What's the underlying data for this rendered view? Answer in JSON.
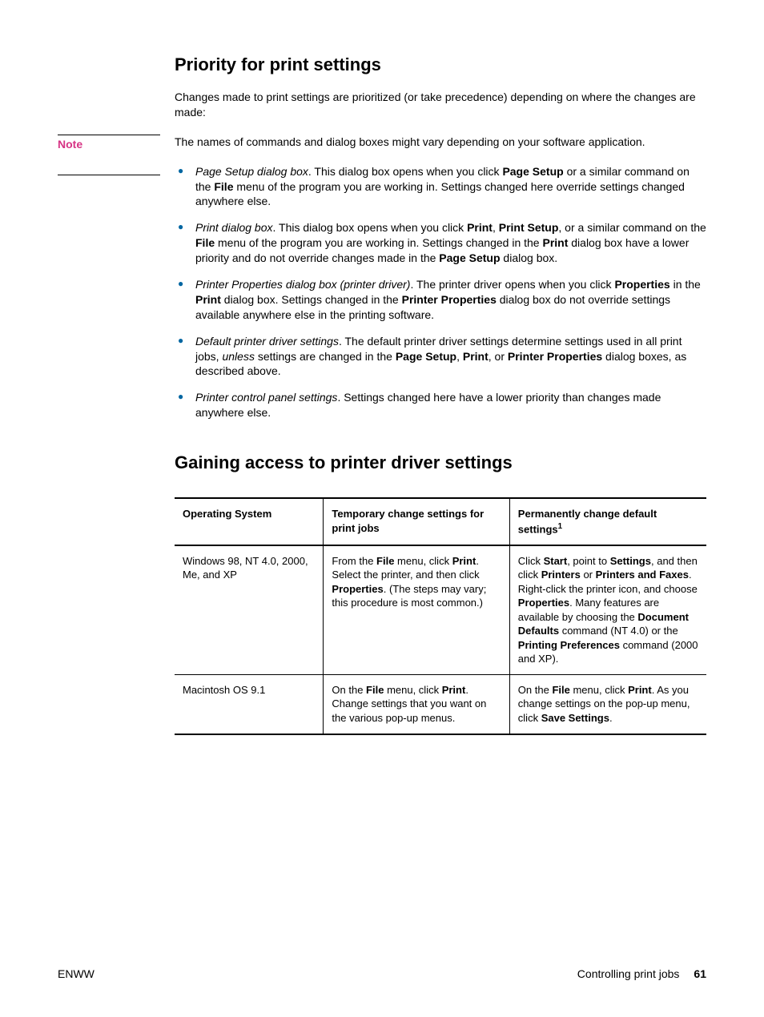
{
  "section1": {
    "heading": "Priority for print settings",
    "intro": "Changes made to print settings are prioritized (or take precedence) depending on where the changes are made:",
    "note_label": "Note",
    "note_text": "The names of commands and dialog boxes might vary depending on your software application.",
    "bullets": [
      {
        "lead_italic": "Page Setup dialog box",
        "t1": ". This dialog box opens when you click ",
        "b1": "Page Setup",
        "t2": " or a similar command on the ",
        "b2": "File",
        "t3": " menu of the program you are working in. Settings changed here override settings changed anywhere else."
      },
      {
        "lead_italic": "Print dialog box",
        "t1": ". This dialog box opens when you click ",
        "b1": "Print",
        "t2": ", ",
        "b2": "Print Setup",
        "t3": ", or a similar command on the ",
        "b3": "File",
        "t4": " menu of the program you are working in. Settings changed in the ",
        "b4": "Print",
        "t5": " dialog box have a lower priority and do not override changes made in the ",
        "b5": "Page Setup",
        "t6": " dialog box."
      },
      {
        "lead_italic": "Printer Properties dialog box (printer driver)",
        "t1": ". The printer driver opens when you click ",
        "b1": "Properties",
        "t2": " in the ",
        "b2": "Print",
        "t3": " dialog box. Settings changed in the ",
        "b3": "Printer Properties",
        "t4": " dialog box do not override settings available anywhere else in the printing software."
      },
      {
        "lead_italic": "Default printer driver settings",
        "t1": ". The default printer driver settings determine settings used in all print jobs, ",
        "i1": "unless",
        "t2": " settings are changed in the ",
        "b1": "Page Setup",
        "t3": ", ",
        "b2": "Print",
        "t4": ", or ",
        "b3": "Printer Properties",
        "t5": " dialog boxes, as described above."
      },
      {
        "lead_italic": "Printer control panel settings",
        "t1": ". Settings changed here have a lower priority than changes made anywhere else."
      }
    ]
  },
  "section2": {
    "heading": "Gaining access to printer driver settings",
    "table": {
      "headers": {
        "os": "Operating System",
        "temp": "Temporary change settings for print jobs",
        "perm_a": "Permanently change default settings",
        "perm_sup": "1"
      },
      "rows": [
        {
          "os": "Windows 98, NT 4.0, 2000, Me, and XP",
          "temp": {
            "t1": "From the ",
            "b1": "File",
            "t2": " menu, click ",
            "b2": "Print",
            "t3": ". Select the printer, and then click ",
            "b3": "Properties",
            "t4": ". (The steps may vary; this procedure is most common.)"
          },
          "perm": {
            "t1": "Click ",
            "b1": "Start",
            "t2": ", point to ",
            "b2": "Settings",
            "t3": ", and then click ",
            "b3": "Printers",
            "t4": " or ",
            "b4": "Printers and Faxes",
            "t5": ". Right-click the printer icon, and choose ",
            "b5": "Properties",
            "t6": ". Many features are available by choosing the ",
            "b6": "Document Defaults",
            "t7": " command (NT 4.0) or the ",
            "b7": "Printing Preferences",
            "t8": " command (2000 and XP)."
          }
        },
        {
          "os": "Macintosh OS 9.1",
          "temp": {
            "t1": "On the ",
            "b1": "File",
            "t2": " menu, click ",
            "b2": "Print",
            "t3": ". Change settings that you want on the various pop-up menus."
          },
          "perm": {
            "t1": "On the ",
            "b1": "File",
            "t2": " menu, click ",
            "b2": "Print",
            "t3": ". As you change settings on the pop-up menu, click ",
            "b3": "Save Settings",
            "t4": "."
          }
        }
      ]
    }
  },
  "footer": {
    "left": "ENWW",
    "right_text": "Controlling print jobs",
    "page_num": "61"
  }
}
